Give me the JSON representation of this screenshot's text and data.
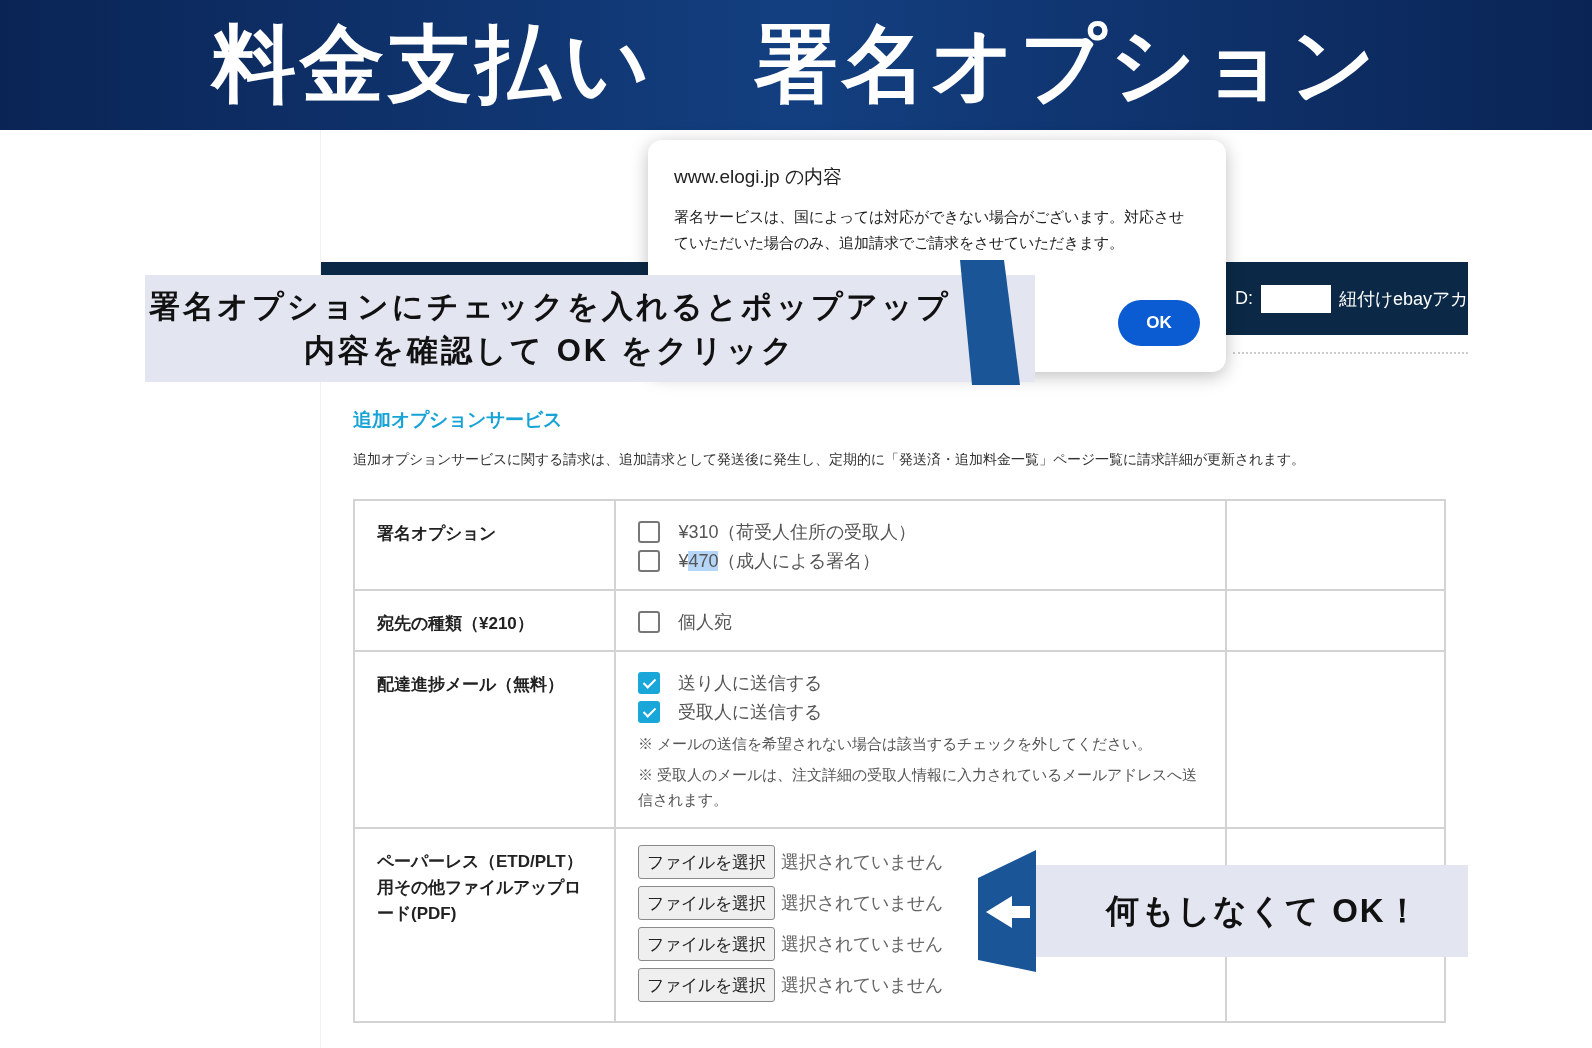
{
  "banner": {
    "title_parts": [
      "料金支払い",
      "署名オプション"
    ]
  },
  "page_header": {
    "id_label": "D:",
    "account_label": "紐付けebayアカ"
  },
  "section": {
    "title": "追加オプションサービス",
    "description": "追加オプションサービスに関する請求は、追加請求として発送後に発生し、定期的に「発送済・追加料金一覧」ページ一覧に請求詳細が更新されます。"
  },
  "table": {
    "rows": [
      {
        "label": "署名オプション",
        "kind": "checkboxes",
        "options": [
          {
            "parts": [
              {
                "text": "¥310（荷受人住所の受取人）",
                "selected": false
              }
            ],
            "checked": false
          },
          {
            "parts": [
              {
                "text": "¥",
                "selected": false
              },
              {
                "text": "470",
                "selected": true
              },
              {
                "text": "（成人による署名）",
                "selected": false
              }
            ],
            "checked": false
          }
        ]
      },
      {
        "label": "宛先の種類（¥210）",
        "kind": "checkboxes",
        "options": [
          {
            "parts": [
              {
                "text": "個人宛",
                "selected": false
              }
            ],
            "checked": false
          }
        ]
      },
      {
        "label": "配達進捗メール（無料）",
        "kind": "checkboxes",
        "options": [
          {
            "parts": [
              {
                "text": "送り人に送信する",
                "selected": false
              }
            ],
            "checked": true
          },
          {
            "parts": [
              {
                "text": "受取人に送信する",
                "selected": false
              }
            ],
            "checked": true
          }
        ],
        "notes": [
          "※ メールの送信を希望されない場合は該当するチェックを外してください。",
          "※ 受取人のメールは、注文詳細の受取人情報に入力されているメールアドレスへ送信されます。"
        ]
      },
      {
        "label": "ペーパーレス（ETD/PLT）用その他ファイルアップロード(PDF)",
        "kind": "files",
        "files": [
          {
            "button": "ファイルを選択",
            "status": "選択されていません"
          },
          {
            "button": "ファイルを選択",
            "status": "選択されていません"
          },
          {
            "button": "ファイルを選択",
            "status": "選択されていません"
          },
          {
            "button": "ファイルを選択",
            "status": "選択されていません"
          }
        ]
      }
    ]
  },
  "dialog": {
    "title": "www.elogi.jp の内容",
    "message": "署名サービスは、国によっては対応ができない場合がございます。対応させていただいた場合のみ、追加請求でご請求をさせていただきます。",
    "ok_button": "OK"
  },
  "callout_top": {
    "lines": [
      "署名オプションにチェックを入れるとポップアップ",
      "内容を確認して OK をクリック"
    ]
  },
  "callout_bottom": {
    "text": "何もしなくて OK！"
  }
}
